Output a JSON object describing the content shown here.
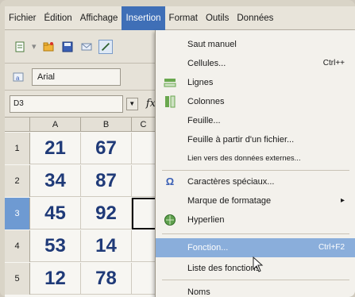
{
  "menubar": {
    "items": [
      "Fichier",
      "Édition",
      "Affichage",
      "Insertion",
      "Format",
      "Outils",
      "Données"
    ]
  },
  "toolbar": {
    "font_name": "Arial"
  },
  "formula": {
    "cell_ref": "D3",
    "fx_label": "fx"
  },
  "grid": {
    "columns": [
      "A",
      "B",
      "C"
    ],
    "rows": [
      {
        "num": "1",
        "a": "21",
        "b": "67"
      },
      {
        "num": "2",
        "a": "34",
        "b": "87"
      },
      {
        "num": "3",
        "a": "45",
        "b": "92"
      },
      {
        "num": "4",
        "a": "53",
        "b": "14"
      },
      {
        "num": "5",
        "a": "12",
        "b": "78"
      }
    ]
  },
  "insert_menu": {
    "items": [
      {
        "label": "Saut manuel",
        "shortcut": "",
        "icon": ""
      },
      {
        "label": "Cellules...",
        "shortcut": "Ctrl++",
        "icon": ""
      },
      {
        "label": "Lignes",
        "shortcut": "",
        "icon": "insert-rows-icon"
      },
      {
        "label": "Colonnes",
        "shortcut": "",
        "icon": "insert-columns-icon"
      },
      {
        "label": "Feuille...",
        "shortcut": "",
        "icon": ""
      },
      {
        "label": "Feuille à partir d'un fichier...",
        "shortcut": "",
        "icon": ""
      },
      {
        "label": "Lien vers des données externes...",
        "shortcut": "",
        "icon": ""
      },
      {
        "label": "Caractères spéciaux...",
        "shortcut": "",
        "icon": "special-characters-icon"
      },
      {
        "label": "Marque de formatage",
        "shortcut": "",
        "icon": ""
      },
      {
        "label": "Hyperlien",
        "shortcut": "",
        "icon": "hyperlink-icon"
      },
      {
        "label": "Fonction...",
        "shortcut": "Ctrl+F2",
        "icon": ""
      },
      {
        "label": "Liste des fonctions",
        "shortcut": "",
        "icon": ""
      },
      {
        "label": "Noms",
        "shortcut": "",
        "icon": ""
      }
    ]
  },
  "colors": {
    "menu_active": "#3f6fb7",
    "menu_highlight": "#8aaedb",
    "cell_text": "#1f3a78",
    "selected_row_header": "#6e9ad2"
  }
}
